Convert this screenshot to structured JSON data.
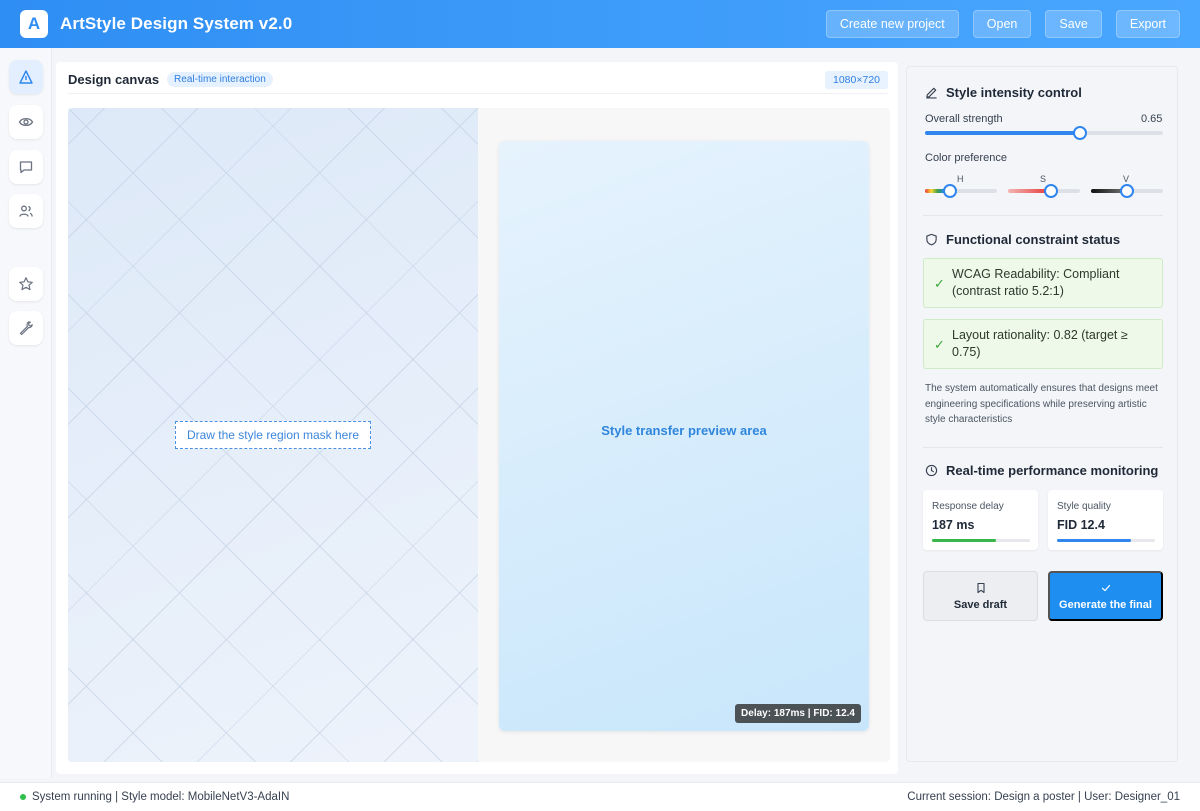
{
  "header": {
    "logo_letter": "A",
    "title": "ArtStyle Design System v2.0",
    "actions": [
      "Create new project",
      "Open",
      "Save",
      "Export"
    ]
  },
  "rail": {
    "items": [
      {
        "icon": "triangle-icon",
        "active": true
      },
      {
        "icon": "eye-icon",
        "active": false
      },
      {
        "icon": "chat-icon",
        "active": false
      },
      {
        "icon": "users-icon",
        "active": false
      },
      {
        "icon": "star-icon",
        "active": false
      },
      {
        "icon": "wrench-icon",
        "active": false
      }
    ]
  },
  "canvas": {
    "title": "Design canvas",
    "badge": "Real-time interaction",
    "size": "1080×720",
    "mask_hint": "Draw the style region mask here",
    "preview_label": "Style transfer preview area",
    "perf_tag": "Delay: 187ms | FID: 12.4"
  },
  "style": {
    "title": "Style intensity control",
    "strength_label": "Overall strength",
    "strength_value": "0.65",
    "strength": 0.65,
    "color_label": "Color preference",
    "hsv": [
      {
        "label": "H",
        "value": 0.35
      },
      {
        "label": "S",
        "value": 0.6
      },
      {
        "label": "V",
        "value": 0.5
      }
    ]
  },
  "constraints": {
    "title": "Functional constraint status",
    "items": [
      "WCAG Readability: Compliant (contrast ratio 5.2:1)",
      "Layout rationality: 0.82 (target ≥ 0.75)"
    ],
    "note": "The system automatically ensures that designs meet engineering specifications while preserving artistic style characteristics"
  },
  "performance": {
    "title": "Real-time performance monitoring",
    "metrics": [
      {
        "label": "Response delay",
        "value": "187 ms",
        "level": 0.65,
        "color": "#39b54a"
      },
      {
        "label": "Style quality",
        "value": "FID 12.4",
        "level": 0.75,
        "color": "#2f86ef"
      }
    ]
  },
  "actions": {
    "draft": "Save draft",
    "final": "Generate the final"
  },
  "footer": {
    "status": "System running | Style model: MobileNetV3-AdaIN",
    "session": "Current session: Design a poster | User: Designer_01"
  }
}
